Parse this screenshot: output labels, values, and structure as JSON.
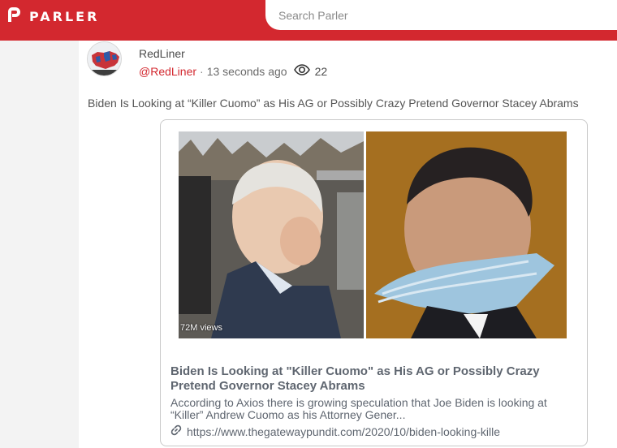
{
  "header": {
    "logo_text": "PARLER",
    "search_placeholder": "Search Parler",
    "brand_color": "#d3282f"
  },
  "post": {
    "author_name": "RedLiner",
    "handle": "@RedLiner",
    "separator": "·",
    "time": "13 seconds ago",
    "view_count": "22",
    "text": "Biden Is Looking at “Killer Cuomo” as His AG or Possibly Crazy Pretend Governor Stacey Abrams"
  },
  "link_card": {
    "image_overlay": "72M views",
    "title": "Biden Is Looking at \"Killer Cuomo\" as His AG or Possibly Crazy Pretend Governor Stacey Abrams",
    "description": "According to Axios there is growing speculation that Joe Biden is looking at “Killer” Andrew Cuomo as his Attorney Gener...",
    "url": "https://www.thegatewaypundit.com/2020/10/biden-looking-kille"
  },
  "icons": {
    "logo": "parler-logo-icon",
    "views": "eye-icon",
    "link": "link-icon"
  }
}
